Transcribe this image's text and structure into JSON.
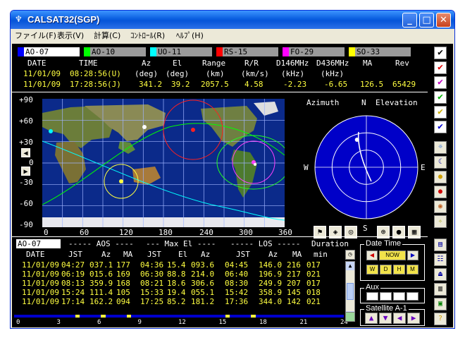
{
  "window": {
    "title": "CALSAT32(SGP)",
    "minimize": "_",
    "maximize": "□",
    "close": "✕"
  },
  "menu": [
    "ファイル(F)",
    "表示(V)",
    "計算(C)",
    "ｺﾝﾄﾛｰﾙ(R)",
    "ﾍﾙﾌﾟ(H)"
  ],
  "satellites": [
    {
      "name": "AO-07",
      "color": "#0000ff",
      "active": true
    },
    {
      "name": "AO-10",
      "color": "#00ff00",
      "active": false
    },
    {
      "name": "UO-11",
      "color": "#00ffff",
      "active": false
    },
    {
      "name": "RS-15",
      "color": "#ff0000",
      "active": false
    },
    {
      "name": "FO-29",
      "color": "#ff00ff",
      "active": false
    },
    {
      "name": "SO-33",
      "color": "#ffff00",
      "active": false
    }
  ],
  "tracking": {
    "headers": [
      "DATE",
      "TIME",
      "Az",
      "El",
      "Range",
      "R/R",
      "D146MHz",
      "D436MHz",
      "MA",
      "Rev"
    ],
    "units": [
      "(deg)",
      "(deg)",
      "(km)",
      "(km/s)",
      "(kHz)",
      "(kHz)"
    ],
    "row1": {
      "date": "11/01/09",
      "time": "08:28:56(U)"
    },
    "row2": {
      "date": "11/01/09",
      "time": "17:28:56(J)",
      "az": "341.2",
      "el": "39.2",
      "range": "2057.5",
      "rr": "4.58",
      "d146": "-2.23",
      "d436": "-6.65",
      "ma": "126.5",
      "rev": "65429"
    }
  },
  "map": {
    "y_labels": [
      "+90",
      "+60",
      "+30",
      "0",
      "-30",
      "-60",
      "-90"
    ],
    "x_labels": [
      "0",
      "60",
      "120",
      "180",
      "240",
      "300",
      "360"
    ]
  },
  "radar": {
    "title_az": "Azimuth",
    "north": "N",
    "title_el": "Elevation",
    "west": "W",
    "east": "E",
    "south": "S",
    "satellite_az_deg": 341.2,
    "satellite_el_deg": 39.2
  },
  "pass_table": {
    "satellite": "AO-07",
    "section_aos": "----- AOS ----",
    "section_max": "--- Max El ----",
    "section_los": "----- LOS -----",
    "section_duration": "Duration",
    "headers": [
      "DATE",
      "JST",
      "Az",
      "MA",
      "JST",
      "El",
      "Az",
      "JST",
      "Az",
      "MA",
      "min"
    ],
    "rows": [
      [
        "11/01/09",
        "04:27",
        "037.1",
        "177",
        "04:36",
        "15.4",
        "093.6",
        "04:45",
        "146.0",
        "216",
        "017"
      ],
      [
        "11/01/09",
        "06:19",
        "015.6",
        "169",
        "06:30",
        "88.8",
        "214.0",
        "06:40",
        "196.9",
        "217",
        "021"
      ],
      [
        "11/01/09",
        "08:13",
        "359.9",
        "168",
        "08:21",
        "18.6",
        "306.6",
        "08:30",
        "249.9",
        "207",
        "017"
      ],
      [
        "11/01/09",
        "15:24",
        "111.4",
        "105",
        "15:33",
        "19.4",
        "055.1",
        "15:42",
        "358.9",
        "145",
        "018"
      ],
      [
        "11/01/09",
        "17:14",
        "162.2",
        "094",
        "17:25",
        "85.2",
        "181.2",
        "17:36",
        "344.0",
        "142",
        "021"
      ]
    ]
  },
  "timeline": {
    "labels": [
      "0",
      "3",
      "6",
      "9",
      "12",
      "15",
      "18",
      "21",
      "24"
    ]
  },
  "controls": {
    "datetime_title": "Date Time",
    "now_label": "NOW",
    "w_label": "W",
    "d_label": "D",
    "h_label": "H",
    "m_label": "M",
    "aux_title": "Aux",
    "satellite_title": "Satellite",
    "satellite_value": "A-1"
  }
}
